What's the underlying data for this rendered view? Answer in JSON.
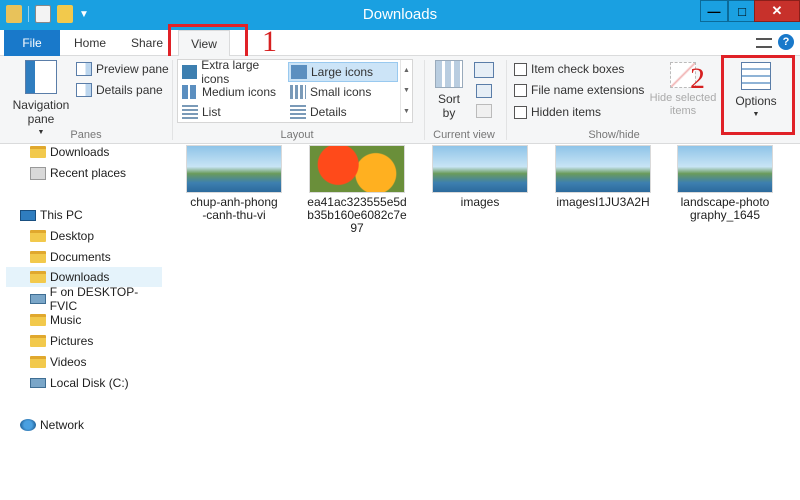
{
  "window": {
    "title": "Downloads",
    "minimize": "—",
    "maximize": "□",
    "close": "✕"
  },
  "tabs": {
    "file": "File",
    "home": "Home",
    "share": "Share",
    "view": "View"
  },
  "callouts": {
    "one": "1",
    "two": "2"
  },
  "ribbon": {
    "panes": {
      "navigation_pane": "Navigation pane",
      "preview_pane": "Preview pane",
      "details_pane": "Details pane",
      "label": "Panes"
    },
    "layout": {
      "items": [
        "Extra large icons",
        "Large icons",
        "Medium icons",
        "Small icons",
        "List",
        "Details"
      ],
      "selected": "Large icons",
      "label": "Layout"
    },
    "current_view": {
      "sort_by": "Sort by",
      "label": "Current view"
    },
    "show_hide": {
      "item_check_boxes": "Item check boxes",
      "file_name_extensions": "File name extensions",
      "hidden_items": "Hidden items",
      "hide_selected_items": "Hide selected items",
      "label": "Show/hide"
    },
    "options": "Options"
  },
  "nav": {
    "items": [
      {
        "label": "Downloads",
        "icon": "folder-icon"
      },
      {
        "label": "Recent places",
        "icon": "recent-places-icon"
      },
      {
        "label": "This PC",
        "icon": "computer-icon"
      },
      {
        "label": "Desktop",
        "icon": "folder-icon"
      },
      {
        "label": "Documents",
        "icon": "folder-icon"
      },
      {
        "label": "Downloads",
        "icon": "folder-icon"
      },
      {
        "label": "F on DESKTOP-FVIC",
        "icon": "network-drive-icon"
      },
      {
        "label": "Music",
        "icon": "folder-icon"
      },
      {
        "label": "Pictures",
        "icon": "folder-icon"
      },
      {
        "label": "Videos",
        "icon": "folder-icon"
      },
      {
        "label": "Local Disk (C:)",
        "icon": "disk-icon"
      },
      {
        "label": "Network",
        "icon": "network-icon"
      }
    ],
    "selected": "Downloads"
  },
  "files": [
    {
      "name": "chup-anh-phong-canh-thu-vi",
      "line1": "chup-anh-phong",
      "line2": "-canh-thu-vi",
      "line3": ""
    },
    {
      "name": "ea41ac323555e5db35b160e6082c7e97",
      "line1": "ea41ac323555e5d",
      "line2": "b35b160e6082c7e",
      "line3": "97"
    },
    {
      "name": "images",
      "line1": "images",
      "line2": "",
      "line3": ""
    },
    {
      "name": "imagesI1JU3A2H",
      "line1": "imagesI1JU3A2H",
      "line2": "",
      "line3": ""
    },
    {
      "name": "landscape-photography_1645",
      "line1": "landscape-photo",
      "line2": "graphy_1645",
      "line3": ""
    }
  ]
}
